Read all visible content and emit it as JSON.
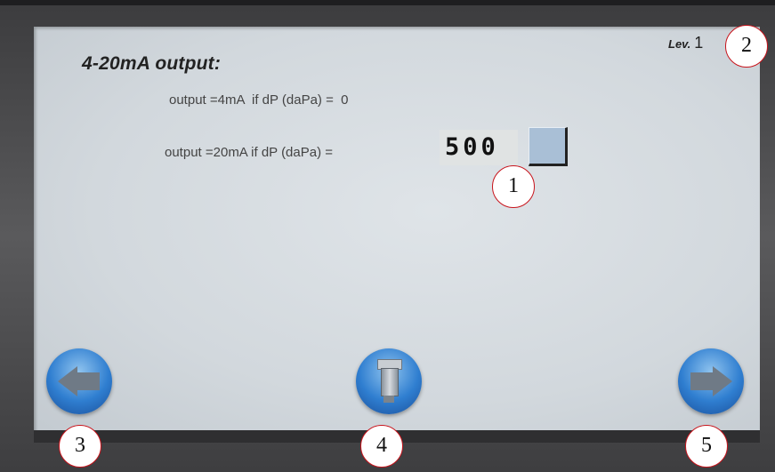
{
  "screen": {
    "title": "4-20mA output:",
    "level_label": "Lev.",
    "level_value": "1",
    "row_min_label": "output =4mA  if dP (daPa) =  0",
    "row_max_label": "output =20mA if dP (daPa) =",
    "max_value": "500"
  },
  "nav": {
    "back_icon": "arrow-left-icon",
    "sensor_icon": "sensor-icon",
    "next_icon": "arrow-right-icon"
  },
  "callouts": [
    "1",
    "2",
    "3",
    "4",
    "5"
  ],
  "colors": {
    "screen_bg": "#d6dce1",
    "nav_button": "#2f7ed0",
    "callout_border": "#c8141c"
  }
}
